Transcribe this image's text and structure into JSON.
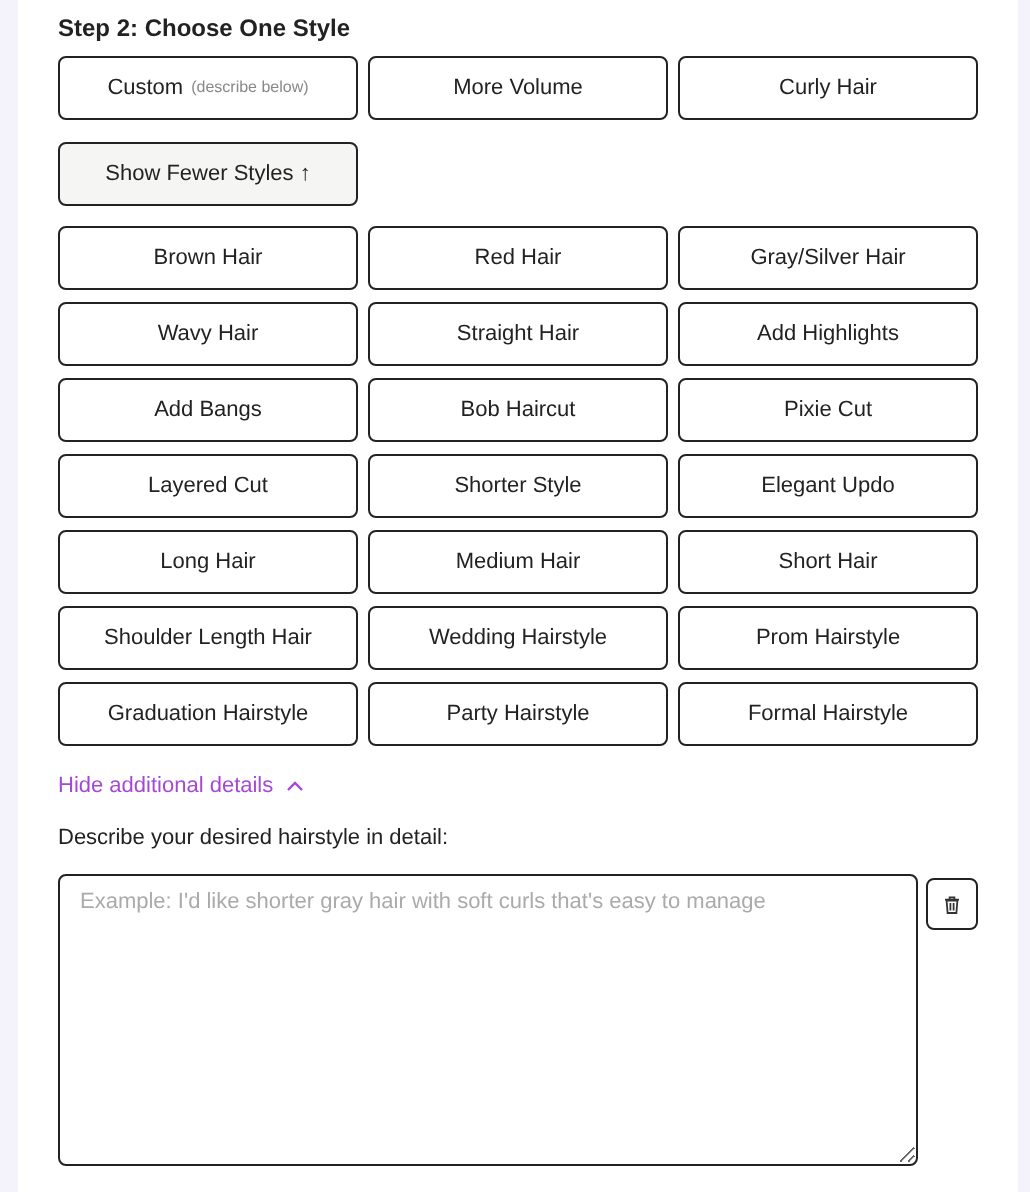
{
  "step_title": "Step 2: Choose One Style",
  "primary_styles": [
    {
      "label": "Custom",
      "note": "(describe below)",
      "selected": false
    },
    {
      "label": "More Volume",
      "selected": false
    },
    {
      "label": "Curly Hair",
      "selected": false
    }
  ],
  "toggle_button": {
    "label": "Show Fewer Styles",
    "arrow": "↑"
  },
  "more_styles": [
    {
      "label": "Brown Hair",
      "selected": false
    },
    {
      "label": "Red Hair",
      "selected": false
    },
    {
      "label": "Gray/Silver Hair",
      "selected": false
    },
    {
      "label": "Wavy Hair",
      "selected": false
    },
    {
      "label": "Straight Hair",
      "selected": false
    },
    {
      "label": "Add Highlights",
      "selected": false
    },
    {
      "label": "Add Bangs",
      "selected": false
    },
    {
      "label": "Bob Haircut",
      "selected": false
    },
    {
      "label": "Pixie Cut",
      "selected": false
    },
    {
      "label": "Layered Cut",
      "selected": false
    },
    {
      "label": "Shorter Style",
      "selected": false
    },
    {
      "label": "Elegant Updo",
      "selected": false
    },
    {
      "label": "Long Hair",
      "selected": false
    },
    {
      "label": "Medium Hair",
      "selected": false
    },
    {
      "label": "Short Hair",
      "selected": false
    },
    {
      "label": "Shoulder Length Hair",
      "selected": false
    },
    {
      "label": "Wedding Hairstyle",
      "selected": false
    },
    {
      "label": "Prom Hairstyle",
      "selected": false
    },
    {
      "label": "Graduation Hairstyle",
      "selected": false
    },
    {
      "label": "Party Hairstyle",
      "selected": false
    },
    {
      "label": "Formal Hairstyle",
      "selected": false
    }
  ],
  "details_toggle": {
    "label": "Hide additional details",
    "expanded": true
  },
  "description": {
    "label": "Describe your desired hairstyle in detail:",
    "placeholder": "Example: I'd like shorter gray hair with soft curls that's easy to manage"
  }
}
